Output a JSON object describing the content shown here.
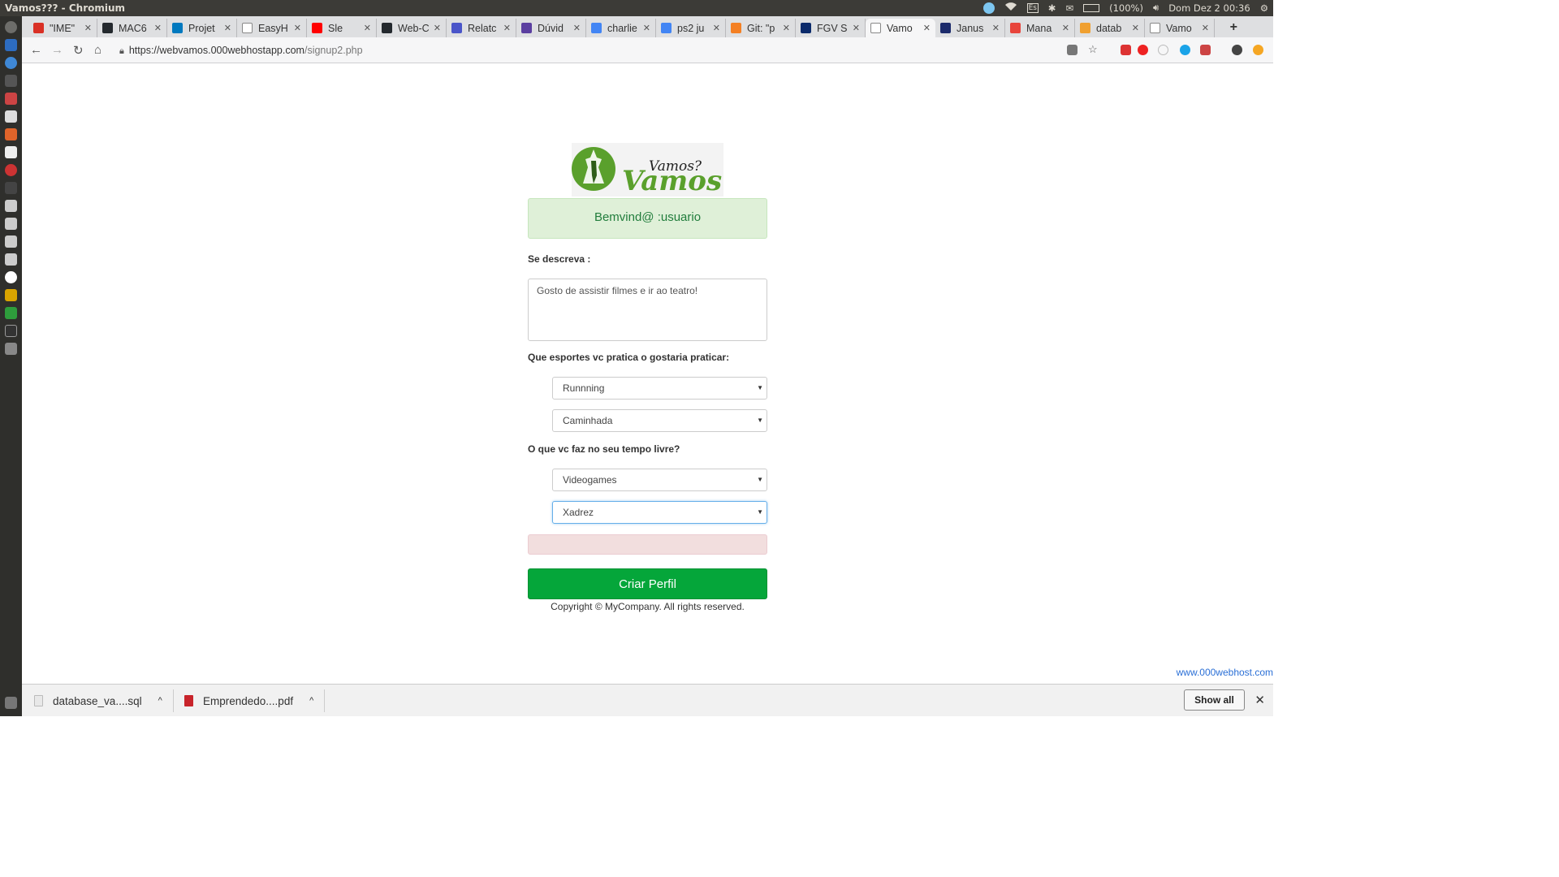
{
  "os": {
    "window_title": "Vamos??? - Chromium",
    "keyboard_layout": "Es",
    "battery": "(100%)",
    "clock": "Dom Dez 2 00:36"
  },
  "browser": {
    "tabs": [
      {
        "label": "\"IME\"",
        "favicon": "gmail-icon",
        "color": "#d93025"
      },
      {
        "label": "MAC6",
        "favicon": "github-icon",
        "color": "#24292e"
      },
      {
        "label": "Projet",
        "favicon": "trello-icon",
        "color": "#0079bf"
      },
      {
        "label": "EasyH",
        "favicon": "page-icon",
        "color": "#ffffff"
      },
      {
        "label": "Sle",
        "favicon": "youtube-icon",
        "color": "#ff0000"
      },
      {
        "label": "Web-C",
        "favicon": "github-icon",
        "color": "#24292e"
      },
      {
        "label": "Relatc",
        "favicon": "docs-icon",
        "color": "#4a55c9"
      },
      {
        "label": "Dúvid",
        "favicon": "forum-icon",
        "color": "#5b3fa0"
      },
      {
        "label": "charlie",
        "favicon": "google-icon",
        "color": "#4285f4"
      },
      {
        "label": "ps2 ju",
        "favicon": "google-icon",
        "color": "#4285f4"
      },
      {
        "label": "Git: \"p",
        "favicon": "stackoverflow-icon",
        "color": "#f48024"
      },
      {
        "label": "FGV S",
        "favicon": "fgv-icon",
        "color": "#0b2a6b"
      },
      {
        "label": "Vamo",
        "favicon": "page-icon",
        "color": "#ffffff",
        "active": true
      },
      {
        "label": "Janus",
        "favicon": "janus-icon",
        "color": "#1b2a6b"
      },
      {
        "label": "Mana",
        "favicon": "manager-icon",
        "color": "#e8453c"
      },
      {
        "label": "datab",
        "favicon": "database-icon",
        "color": "#f0a030"
      },
      {
        "label": "Vamo",
        "favicon": "page-icon",
        "color": "#ffffff"
      }
    ],
    "url_host": "https://webvamos.000webhostapp.com",
    "url_path": "/signup2.php"
  },
  "page": {
    "logo_text_top": "Vamos?",
    "logo_text_main": "Vamos!",
    "welcome": "Bemvind@ :usuario",
    "about_label": "Se descreva :",
    "about_value": "Gosto de assistir filmes e ir ao teatro!",
    "sports_label": "Que esportes vc pratica o gostaria praticar:",
    "sport_1": "Runnning",
    "sport_2": "Caminhada",
    "free_time_label": "O que vc faz no seu tempo livre?",
    "hobby_1": "Videogames",
    "hobby_2": "Xadrez",
    "submit_label": "Criar Perfil",
    "copyright": "Copyright © MyCompany. All rights reserved.",
    "host_link": "www.000webhost.com"
  },
  "downloads": {
    "items": [
      {
        "name": "database_va....sql"
      },
      {
        "name": "Emprendedo....pdf"
      }
    ],
    "show_all": "Show all"
  },
  "colors": {
    "accent_green": "#05a63a",
    "welcome_bg": "#dff0d8",
    "error_bg": "#f2dede",
    "brand_green": "#5aa02c"
  }
}
